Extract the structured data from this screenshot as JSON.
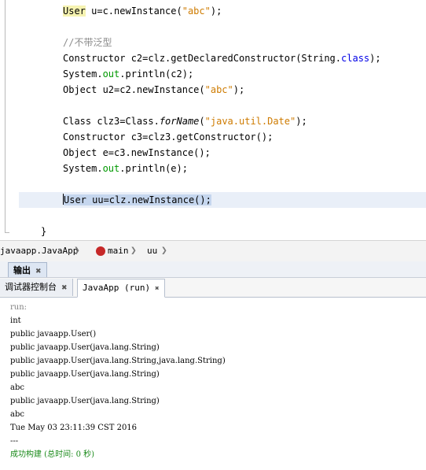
{
  "editor": {
    "lines": {
      "l1_type": "User",
      "l1_rest": " u=c.newInstance(",
      "l1_str": "\"abc\"",
      "l1_end": ");",
      "l2_comment": "//不带泛型",
      "l3_a": "Constructor c2=clz.getDeclaredConstructor(String.",
      "l3_kw": "class",
      "l3_end": ");",
      "l4_a": "System.",
      "l4_fld": "out",
      "l4_b": ".println(c2);",
      "l5_a": "Object u2=c2.newInstance(",
      "l5_str": "\"abc\"",
      "l5_end": ");",
      "l6_a": "Class clz3=Class.",
      "l6_method": "forName",
      "l6_b": "(",
      "l6_str": "\"java.util.Date\"",
      "l6_end": ");",
      "l7": "Constructor c3=clz3.getConstructor();",
      "l8": "Object e=c3.newInstance();",
      "l9_a": "System.",
      "l9_fld": "out",
      "l9_b": ".println(e);",
      "l10_type": "User",
      "l10_rest": " uu=clz.newInstance();",
      "closing_brace": "}"
    }
  },
  "breadcrumb": {
    "items": [
      "javaapp.JavaApp",
      "main",
      "uu"
    ],
    "separator": "❯"
  },
  "output_window": {
    "title": "输出",
    "close_glyph": "✖"
  },
  "console_tabs": {
    "tab1": "调试器控制台",
    "tab2": "JavaApp (run)",
    "close_glyph": "✖"
  },
  "console": {
    "lines": [
      "run:",
      "int",
      "public javaapp.User()",
      "public javaapp.User(java.lang.String)",
      "public javaapp.User(java.lang.String,java.lang.String)",
      "public javaapp.User(java.lang.String)",
      "abc",
      "public javaapp.User(java.lang.String)",
      "abc",
      "Tue May 03 23:11:39 CST 2016",
      "---",
      "成功构建 (总时间: 0 秒)"
    ]
  },
  "colors": {
    "keyword": "#0000e6",
    "string": "#ce7b00",
    "field": "#009900",
    "comment": "#8c8c8c",
    "success": "#1a8a1a"
  }
}
